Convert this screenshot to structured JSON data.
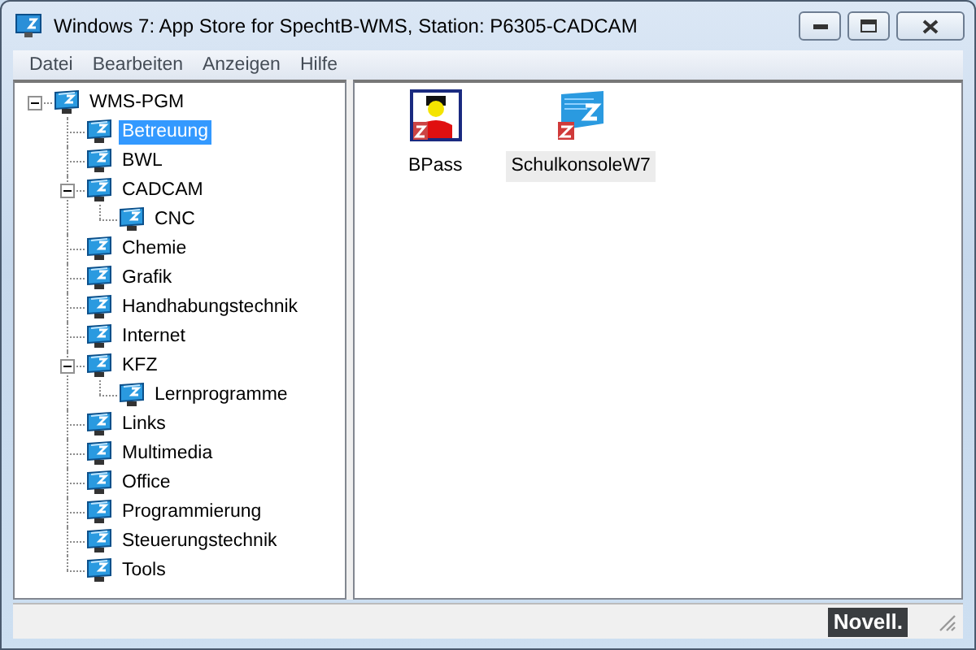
{
  "window": {
    "title": "Windows 7: App Store for SpechtB-WMS, Station: P6305-CADCAM"
  },
  "menu": [
    "Datei",
    "Bearbeiten",
    "Anzeigen",
    "Hilfe"
  ],
  "tree": [
    {
      "label": "WMS-PGM",
      "selected": false,
      "expanded": true,
      "children": [
        {
          "label": "Betreuung",
          "selected": true
        },
        {
          "label": "BWL",
          "selected": false
        },
        {
          "label": "CADCAM",
          "selected": false,
          "expanded": true,
          "children": [
            {
              "label": "CNC",
              "selected": false
            }
          ]
        },
        {
          "label": "Chemie",
          "selected": false
        },
        {
          "label": "Grafik",
          "selected": false
        },
        {
          "label": "Handhabungstechnik",
          "selected": false
        },
        {
          "label": "Internet",
          "selected": false
        },
        {
          "label": "KFZ",
          "selected": false,
          "expanded": true,
          "children": [
            {
              "label": "Lernprogramme",
              "selected": false
            }
          ]
        },
        {
          "label": "Links",
          "selected": false
        },
        {
          "label": "Multimedia",
          "selected": false
        },
        {
          "label": "Office",
          "selected": false
        },
        {
          "label": "Programmierung",
          "selected": false
        },
        {
          "label": "Steuerungstechnik",
          "selected": false
        },
        {
          "label": "Tools",
          "selected": false
        }
      ]
    }
  ],
  "apps": [
    {
      "label": "BPass",
      "kind": "person",
      "selected": false
    },
    {
      "label": "SchulkonsoleW7",
      "kind": "console",
      "selected": true
    }
  ],
  "status_bar": {
    "logo": "Novell."
  }
}
